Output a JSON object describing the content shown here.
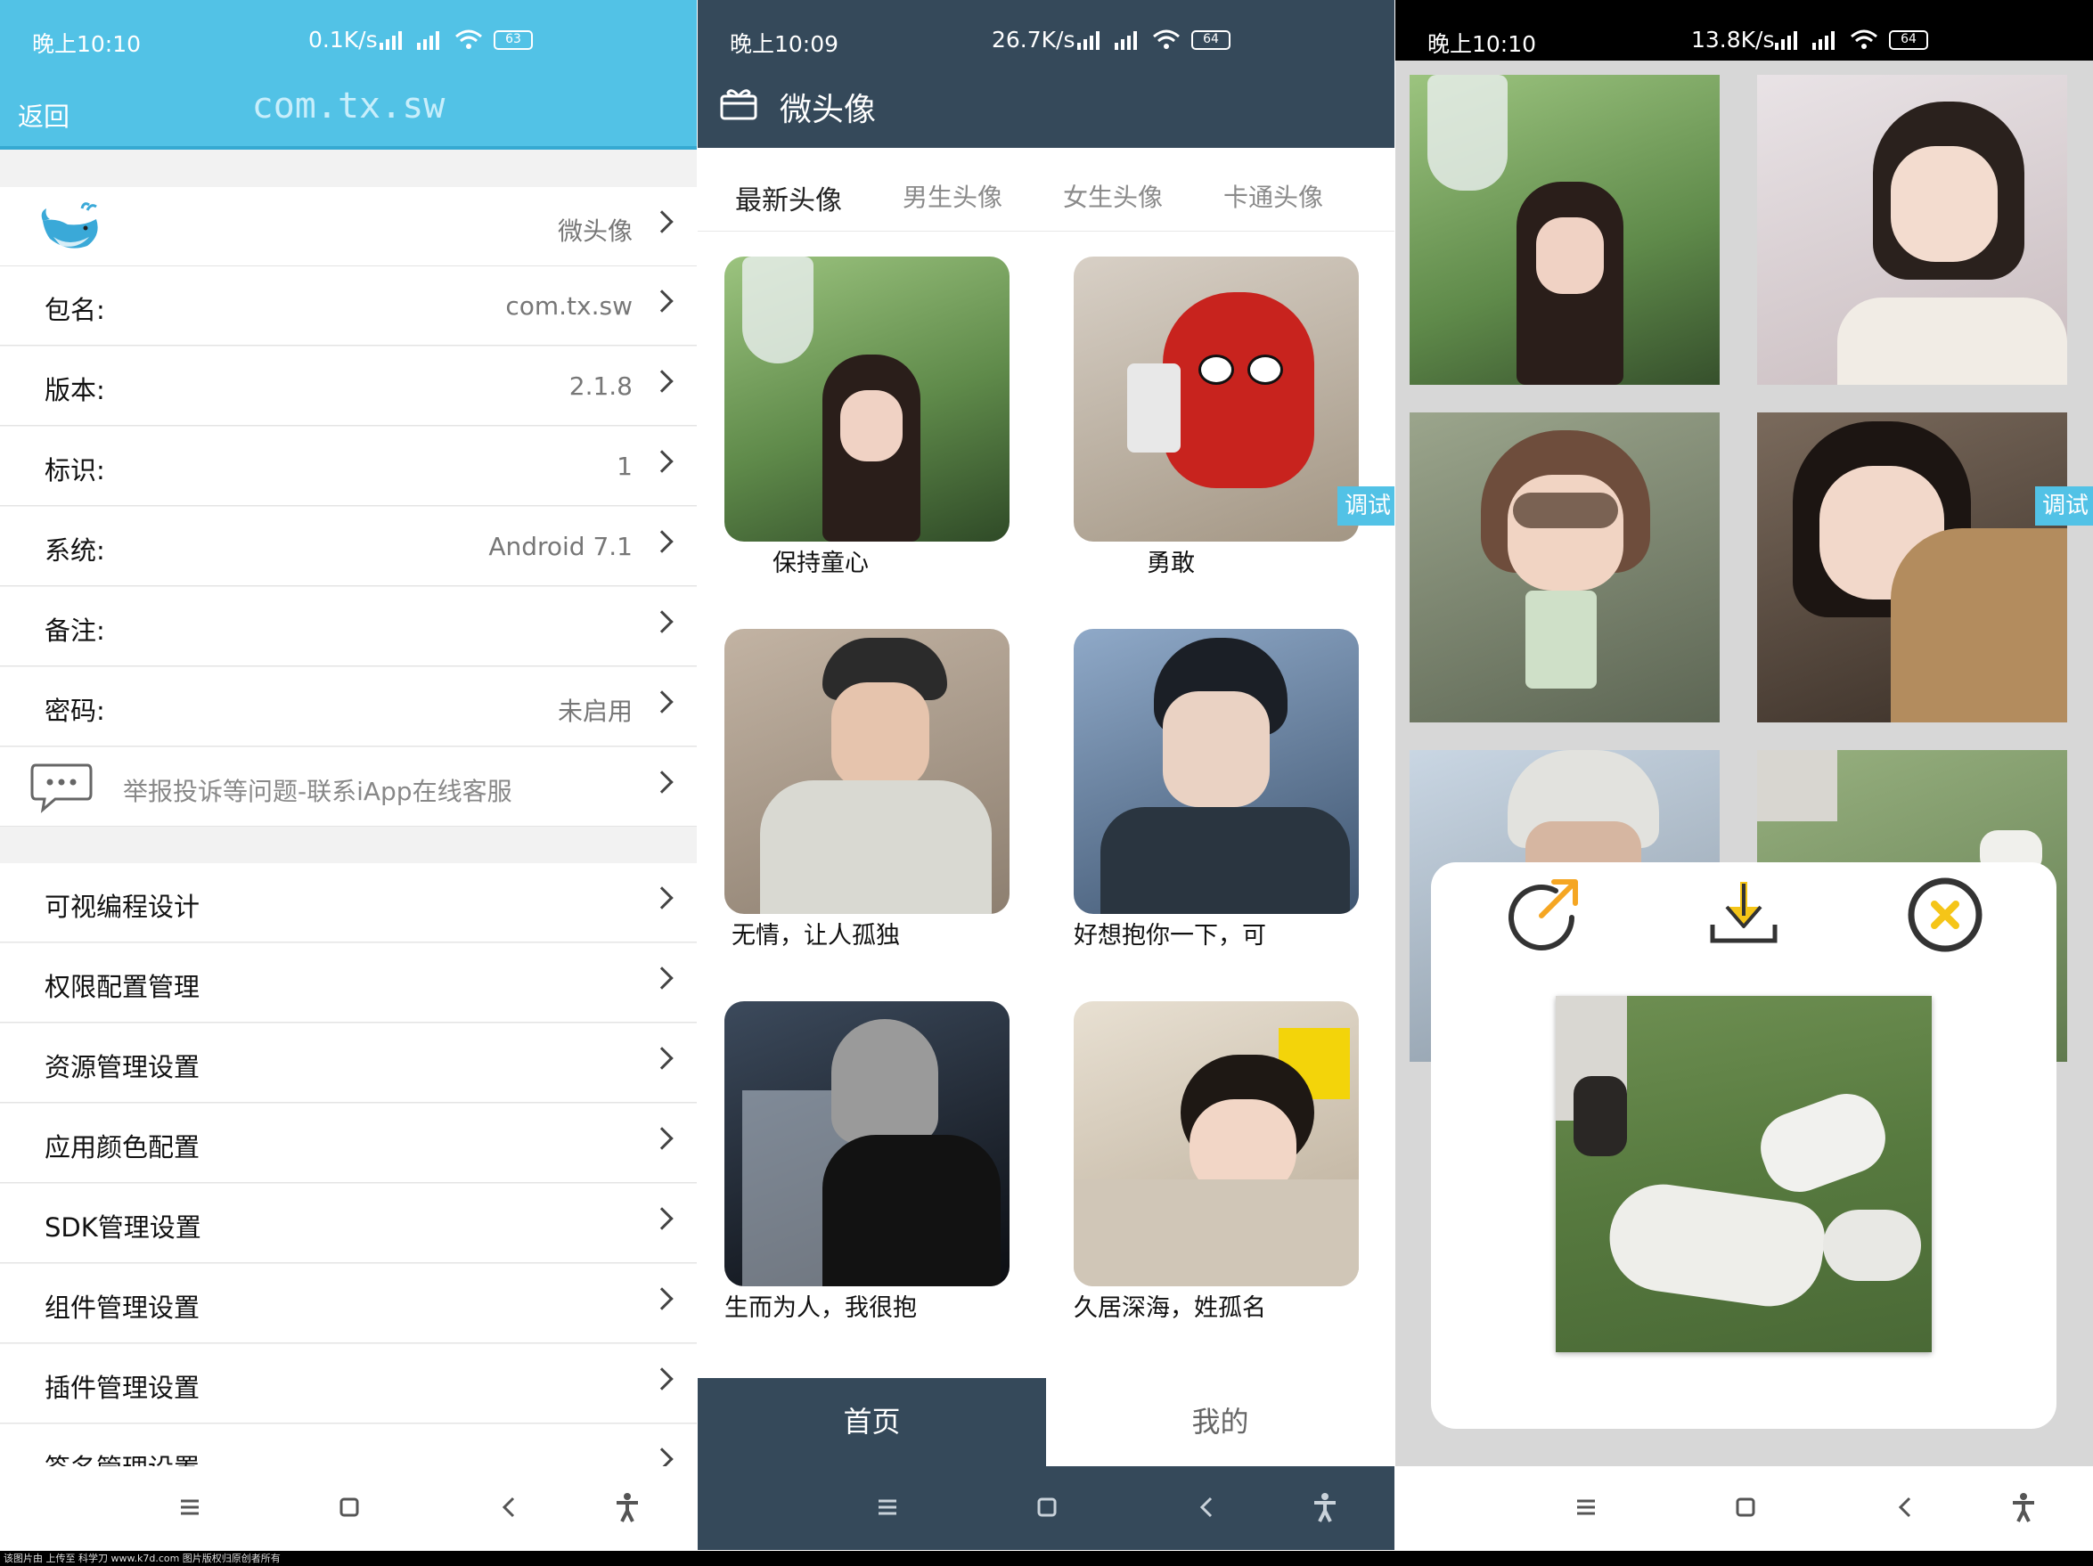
{
  "screen1": {
    "status": {
      "time": "晚上10:10",
      "speed": "0.1K/s",
      "battery": "63"
    },
    "topbar": {
      "back": "返回",
      "title": "com.tx.sw"
    },
    "app_row": {
      "value": "微头像"
    },
    "info_rows": [
      {
        "label": "包名:",
        "value": "com.tx.sw"
      },
      {
        "label": "版本:",
        "value": "2.1.8"
      },
      {
        "label": "标识:",
        "value": "1"
      },
      {
        "label": "系统:",
        "value": "Android 7.1"
      },
      {
        "label": "备注:",
        "value": ""
      },
      {
        "label": "密码:",
        "value": "未启用"
      }
    ],
    "report": "举报投诉等问题-联系iApp在线客服",
    "menu": [
      "可视编程设计",
      "权限配置管理",
      "资源管理设置",
      "应用颜色配置",
      "SDK管理设置",
      "组件管理设置",
      "插件管理设置",
      "签名管理设置"
    ]
  },
  "screen2": {
    "status": {
      "time": "晚上10:09",
      "speed": "26.7K/s",
      "battery": "64"
    },
    "title": "微头像",
    "tabs": [
      "最新头像",
      "男生头像",
      "女生头像",
      "卡通头像"
    ],
    "cards": [
      "保持童心",
      "勇敢",
      "无情，让人孤独",
      "好想抱你一下，可",
      "生而为人，我很抱",
      "久居深海，姓孤名"
    ],
    "debug": "调试",
    "nav": {
      "home": "首页",
      "mine": "我的"
    }
  },
  "screen3": {
    "status": {
      "time": "晚上10:10",
      "speed": "13.8K/s",
      "battery": "64"
    },
    "debug": "调试"
  },
  "footer": "该图片由 上传至 科学刀 www.k7d.com 图片版权归原创者所有",
  "colors": {
    "accent_blue": "#52c2e6",
    "dark_slate": "#35495a",
    "yellow": "#f5c518"
  }
}
